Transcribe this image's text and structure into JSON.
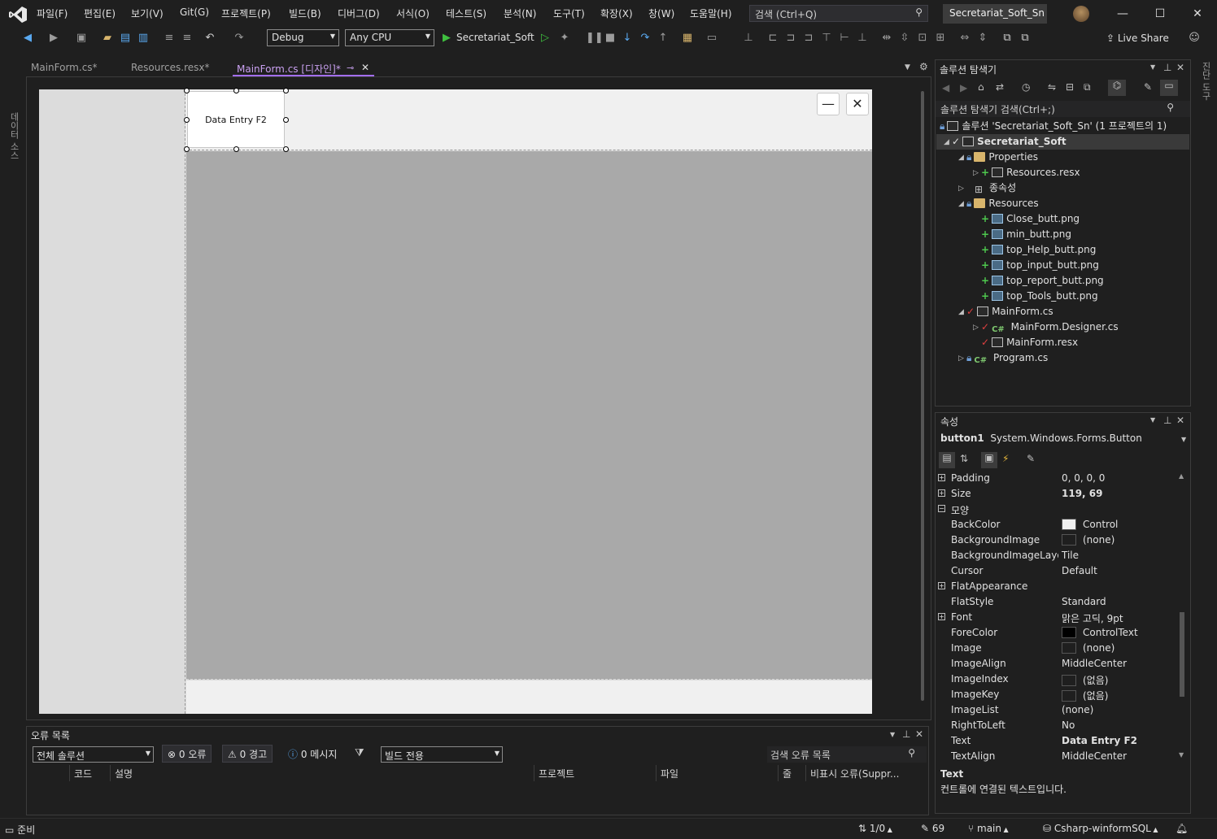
{
  "window": {
    "search_placeholder": "검색 (Ctrl+Q)",
    "solution_name": "Secretariat_Soft_Sn"
  },
  "menu": [
    "파일(F)",
    "편집(E)",
    "보기(V)",
    "Git(G)",
    "프로젝트(P)",
    "빌드(B)",
    "디버그(D)",
    "서식(O)",
    "테스트(S)",
    "분석(N)",
    "도구(T)",
    "확장(X)",
    "창(W)",
    "도움말(H)"
  ],
  "toolbar": {
    "config": "Debug",
    "platform": "Any CPU",
    "start_target": "Secretariat_Soft",
    "live_share": "Live Share"
  },
  "left_strip_label": "데이터 소스",
  "right_strip_label": "진단 도구",
  "tabs": [
    {
      "label": "MainForm.cs*"
    },
    {
      "label": "Resources.resx*"
    },
    {
      "label": "MainForm.cs [디자인]*"
    }
  ],
  "designer": {
    "button_text": "Data Entry F2",
    "minimize_glyph": "—",
    "close_glyph": "✕"
  },
  "error_list": {
    "title": "오류 목록",
    "scope": "전체 솔루션",
    "errors": "0 오류",
    "warnings": "0 경고",
    "messages": "0 메시지",
    "build_filter": "빌드 전용",
    "search_placeholder": "검색 오류 목록",
    "columns": [
      "코드",
      "설명",
      "프로젝트",
      "파일",
      "줄",
      "비표시 오류(Suppr..."
    ]
  },
  "solution_explorer": {
    "title": "솔루션 탐색기",
    "search_placeholder": "솔루션 탐색기 검색(Ctrl+;)",
    "solution_label": "솔루션 'Secretariat_Soft_Sn' (1 프로젝트의 1)",
    "project": "Secretariat_Soft",
    "items": [
      "Properties",
      "Resources.resx",
      "종속성",
      "Resources",
      "Close_butt.png",
      "min_butt.png",
      "top_Help_butt.png",
      "top_input_butt.png",
      "top_report_butt.png",
      "top_Tools_butt.png",
      "MainForm.cs",
      "MainForm.Designer.cs",
      "MainForm.resx",
      "Program.cs"
    ]
  },
  "properties": {
    "title": "속성",
    "object_name": "button1",
    "object_type": "System.Windows.Forms.Button",
    "rows": [
      {
        "name": "Padding",
        "value": "0, 0, 0, 0"
      },
      {
        "name": "Size",
        "value": "119, 69"
      },
      {
        "name": "모양",
        "value": ""
      },
      {
        "name": "BackColor",
        "value": "Control",
        "swatch": "#f0f0f0"
      },
      {
        "name": "BackgroundImage",
        "value": "(none)",
        "swatch": "#1f1f1f"
      },
      {
        "name": "BackgroundImageLayout",
        "value": "Tile"
      },
      {
        "name": "Cursor",
        "value": "Default"
      },
      {
        "name": "FlatAppearance",
        "value": ""
      },
      {
        "name": "FlatStyle",
        "value": "Standard"
      },
      {
        "name": "Font",
        "value": "맑은 고딕, 9pt"
      },
      {
        "name": "ForeColor",
        "value": "ControlText",
        "swatch": "#000000"
      },
      {
        "name": "Image",
        "value": "(none)",
        "swatch": "#1f1f1f"
      },
      {
        "name": "ImageAlign",
        "value": "MiddleCenter"
      },
      {
        "name": "ImageIndex",
        "value": "(없음)",
        "swatch": "#1f1f1f"
      },
      {
        "name": "ImageKey",
        "value": "(없음)",
        "swatch": "#1f1f1f"
      },
      {
        "name": "ImageList",
        "value": "(none)"
      },
      {
        "name": "RightToLeft",
        "value": "No"
      },
      {
        "name": "Text",
        "value": "Data Entry F2"
      },
      {
        "name": "TextAlign",
        "value": "MiddleCenter"
      }
    ],
    "desc_title": "Text",
    "desc_text": "컨트롤에 연결된 텍스트입니다."
  },
  "status": {
    "ready": "준비",
    "line_col": "1/0",
    "edits": "69",
    "branch": "main",
    "repo": "Csharp-winformSQL"
  },
  "colors": {
    "accent": "#a36ef0",
    "designer_gray": "#a9a9a9",
    "form_panel": "#f0f0f0"
  }
}
